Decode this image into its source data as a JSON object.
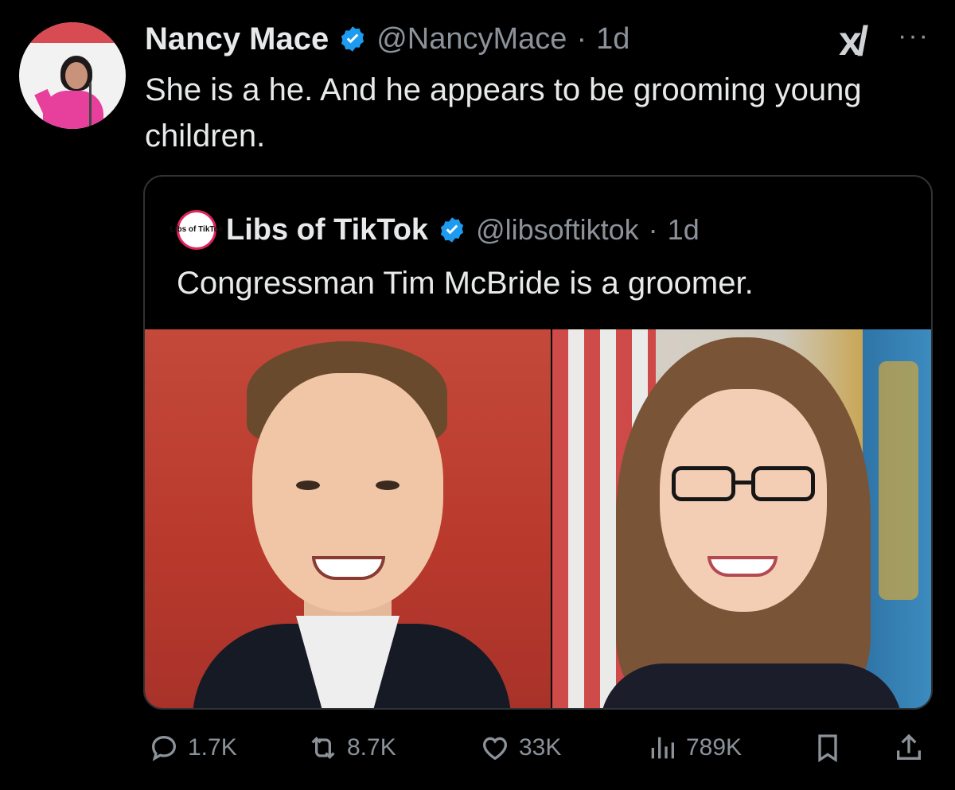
{
  "tweet": {
    "author_name": "Nancy Mace",
    "author_handle": "@NancyMace",
    "separator": "·",
    "time": "1d",
    "text": "She is a he. And he appears to be grooming young children.",
    "more_label": "···",
    "grok_label": "x/"
  },
  "quoted": {
    "avatar_text": "Libs of TikTok",
    "author_name": "Libs of TikTok",
    "author_handle": "@libsoftiktok",
    "separator": "·",
    "time": "1d",
    "text": "Congressman Tim McBride is a groomer."
  },
  "actions": {
    "replies": "1.7K",
    "reposts": "8.7K",
    "likes": "33K",
    "views": "789K"
  },
  "colors": {
    "background": "#000000",
    "text": "#e7e9ea",
    "secondary": "#8b9299",
    "verified": "#1d9bf0",
    "border": "#2f3336"
  },
  "icons": [
    "verified-badge-icon",
    "reply-icon",
    "repost-icon",
    "like-icon",
    "views-icon",
    "bookmark-icon",
    "share-icon",
    "more-icon",
    "grok-icon"
  ]
}
